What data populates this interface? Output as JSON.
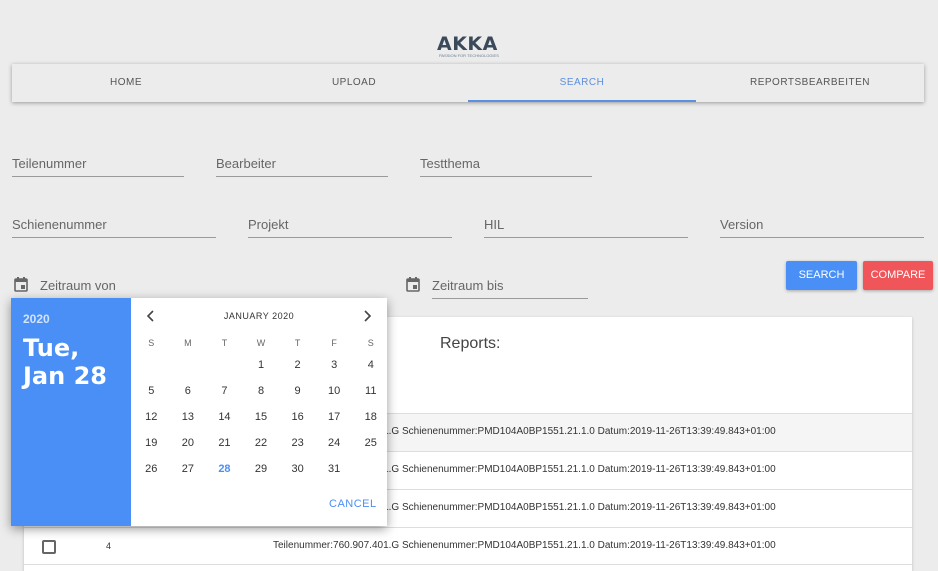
{
  "logo": {
    "text": "AKKA",
    "tagline": "PASSION FOR TECHNOLOGIES"
  },
  "nav": {
    "items": [
      "HOME",
      "UPLOAD",
      "SEARCH",
      "REPORTSBEARBEITEN"
    ],
    "active": "SEARCH"
  },
  "form": {
    "teilenummer": "Teilenummer",
    "bearbeiter": "Bearbeiter",
    "testthema": "Testthema",
    "schienenummer": "Schienenummer",
    "projekt": "Projekt",
    "hil": "HIL",
    "version": "Version",
    "zeitraum_von": "Zeitraum von",
    "zeitraum_bis": "Zeitraum bis"
  },
  "buttons": {
    "search": "SEARCH",
    "compare": "COMPARE"
  },
  "reports": {
    "title": "Reports:",
    "rows": [
      {
        "num": "",
        "text": "Teilenummer:760.907.401.G Schienenummer:PMD104A0BP1551.21.1.0 Datum:2019-11-26T13:39:49.843+01:00"
      },
      {
        "num": "",
        "text": "Teilenummer:760.907.401.G Schienenummer:PMD104A0BP1551.21.1.0 Datum:2019-11-26T13:39:49.843+01:00"
      },
      {
        "num": "",
        "text": "Teilenummer:760.907.401.G Schienenummer:PMD104A0BP1551.21.1.0 Datum:2019-11-26T13:39:49.843+01:00"
      },
      {
        "num": "4",
        "text": "Teilenummer:760.907.401.G Schienenummer:PMD104A0BP1551.21.1.0 Datum:2019-11-26T13:39:49.843+01:00"
      }
    ]
  },
  "datepicker": {
    "year": "2020",
    "date_line1": "Tue,",
    "date_line2": "Jan 28",
    "month": "JANUARY 2020",
    "weekdays": [
      "S",
      "M",
      "T",
      "W",
      "T",
      "F",
      "S"
    ],
    "weeks": [
      [
        "",
        "",
        "",
        "1",
        "2",
        "3",
        "4"
      ],
      [
        "5",
        "6",
        "7",
        "8",
        "9",
        "10",
        "11"
      ],
      [
        "12",
        "13",
        "14",
        "15",
        "16",
        "17",
        "18"
      ],
      [
        "19",
        "20",
        "21",
        "22",
        "23",
        "24",
        "25"
      ],
      [
        "26",
        "27",
        "28",
        "29",
        "30",
        "31",
        ""
      ]
    ],
    "selected": "28",
    "cancel": "CANCEL"
  },
  "colors": {
    "accent": "#4a8ff5",
    "danger": "#f0555a"
  }
}
